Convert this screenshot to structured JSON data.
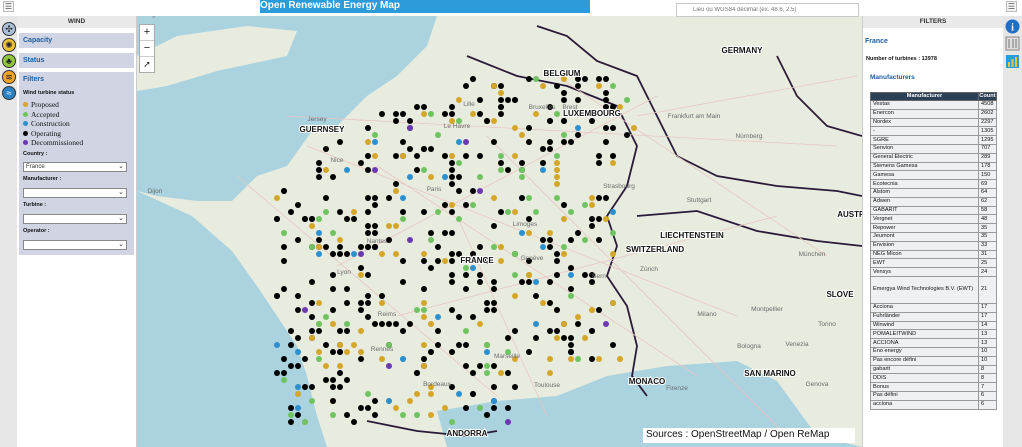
{
  "app": {
    "title": "Open Renewable Energy Map"
  },
  "search": {
    "placeholder": "Lieu ou WGS84 décimal (ex. 48.6, 2.5)"
  },
  "left_panel": {
    "title": "WIND",
    "sections": [
      "Capacity",
      "Status"
    ],
    "filters": {
      "title": "Filters",
      "status_label": "Wind turbine status",
      "legend": [
        {
          "label": "Proposed",
          "color": "#d4a629"
        },
        {
          "label": "Accepted",
          "color": "#6fc361"
        },
        {
          "label": "Construction",
          "color": "#2c8fd0"
        },
        {
          "label": "Operating",
          "color": "#000000"
        },
        {
          "label": "Decommissioned",
          "color": "#6a38b0"
        }
      ],
      "country_label": "Country :",
      "country_value": "France",
      "manufacturer_label": "Manufacturer :",
      "manufacturer_value": "",
      "turbine_label": "Turbine :",
      "turbine_value": "",
      "operator_label": "Operator :",
      "operator_value": ""
    }
  },
  "map": {
    "zoom_in": "+",
    "zoom_out": "−",
    "labels": [
      {
        "text": "GERMANY",
        "style": "country"
      },
      {
        "text": "BELGIUM",
        "style": "country"
      },
      {
        "text": "LUXEMBOURG",
        "style": "country"
      },
      {
        "text": "GUERNSEY",
        "style": "country"
      },
      {
        "text": "FRANCE",
        "style": "country"
      },
      {
        "text": "SWITZERLAND",
        "style": "country"
      },
      {
        "text": "LIECHTENSTEIN",
        "style": "country"
      },
      {
        "text": "AUSTRIA",
        "style": "country"
      },
      {
        "text": "SLOVE",
        "style": "country"
      },
      {
        "text": "MONACO",
        "style": "country"
      },
      {
        "text": "SAN MARINO",
        "style": "country"
      },
      {
        "text": "ANDORRA",
        "style": "country"
      },
      {
        "text": "Paris",
        "style": "city"
      },
      {
        "text": "Lille",
        "style": "city"
      },
      {
        "text": "Bruxelles",
        "style": "city"
      },
      {
        "text": "Frankfurt am Main",
        "style": "city"
      },
      {
        "text": "Nürnberg",
        "style": "city"
      },
      {
        "text": "Stuttgart",
        "style": "city"
      },
      {
        "text": "Strasbourg",
        "style": "city"
      },
      {
        "text": "München",
        "style": "city"
      },
      {
        "text": "Zürich",
        "style": "city"
      },
      {
        "text": "Bern",
        "style": "city"
      },
      {
        "text": "Genève",
        "style": "city"
      },
      {
        "text": "Lyon",
        "style": "city"
      },
      {
        "text": "Nantes",
        "style": "city"
      },
      {
        "text": "Rennes",
        "style": "city"
      },
      {
        "text": "Bordeaux",
        "style": "city"
      },
      {
        "text": "Toulouse",
        "style": "city"
      },
      {
        "text": "Marseille",
        "style": "city"
      },
      {
        "text": "Montpellier",
        "style": "city"
      },
      {
        "text": "Milano",
        "style": "city"
      },
      {
        "text": "Torino",
        "style": "city"
      },
      {
        "text": "Venezia",
        "style": "city"
      },
      {
        "text": "Bologna",
        "style": "city"
      },
      {
        "text": "Genova",
        "style": "city"
      },
      {
        "text": "Firenze",
        "style": "city"
      },
      {
        "text": "Nice",
        "style": "city"
      },
      {
        "text": "Jersey",
        "style": "city"
      },
      {
        "text": "Le Havre",
        "style": "city"
      },
      {
        "text": "Reims",
        "style": "city"
      },
      {
        "text": "Limoges",
        "style": "city"
      },
      {
        "text": "Dijon",
        "style": "city"
      },
      {
        "text": "Brest",
        "style": "city"
      },
      {
        "text": "Luxembourg",
        "style": "city"
      }
    ],
    "sources": "Sources : OpenStreetMap / Open ReMap"
  },
  "right_panel": {
    "title": "FILTERS",
    "country": "France",
    "turbine_count_label": "Number of turbines : 13978",
    "manufacturers_title": "Manufacturers",
    "table_headers": [
      "Manufacturer",
      "Count"
    ],
    "rows": [
      [
        "Vestas",
        "4508"
      ],
      [
        "Enercon",
        "2602"
      ],
      [
        "Nordex",
        "2297"
      ],
      [
        "-",
        "1305"
      ],
      [
        "SGRE",
        "1295"
      ],
      [
        "Senvion",
        "707"
      ],
      [
        "General Electric",
        "289"
      ],
      [
        "Siemens Gamesa",
        "178"
      ],
      [
        "Gamesa",
        "150"
      ],
      [
        "Ecotecnia",
        "69"
      ],
      [
        "Alstom",
        "64"
      ],
      [
        "Adwen",
        "62"
      ],
      [
        "GABARIT",
        "58"
      ],
      [
        "Vergnet",
        "48"
      ],
      [
        "Repower",
        "35"
      ],
      [
        "Jeumont",
        "35"
      ],
      [
        "Envision",
        "33"
      ],
      [
        "NEG Micon",
        "31"
      ],
      [
        "EWT",
        "25"
      ],
      [
        "Vensys",
        "24"
      ],
      [
        "Emergya Wind Technologies B.V. (EWT)",
        "21"
      ],
      [
        "Acciona",
        "17"
      ],
      [
        "Fuhrländer",
        "17"
      ],
      [
        "Winwind",
        "14"
      ],
      [
        "POMALEITWIND",
        "13"
      ],
      [
        "ACCIONA",
        "13"
      ],
      [
        "Eno energy",
        "10"
      ],
      [
        "Pas encore défini",
        "10"
      ],
      [
        "gabarit",
        "8"
      ],
      [
        "DDIS",
        "8"
      ],
      [
        "Bonus",
        "7"
      ],
      [
        "Pas défini",
        "6"
      ],
      [
        "acciona",
        "6"
      ]
    ]
  }
}
